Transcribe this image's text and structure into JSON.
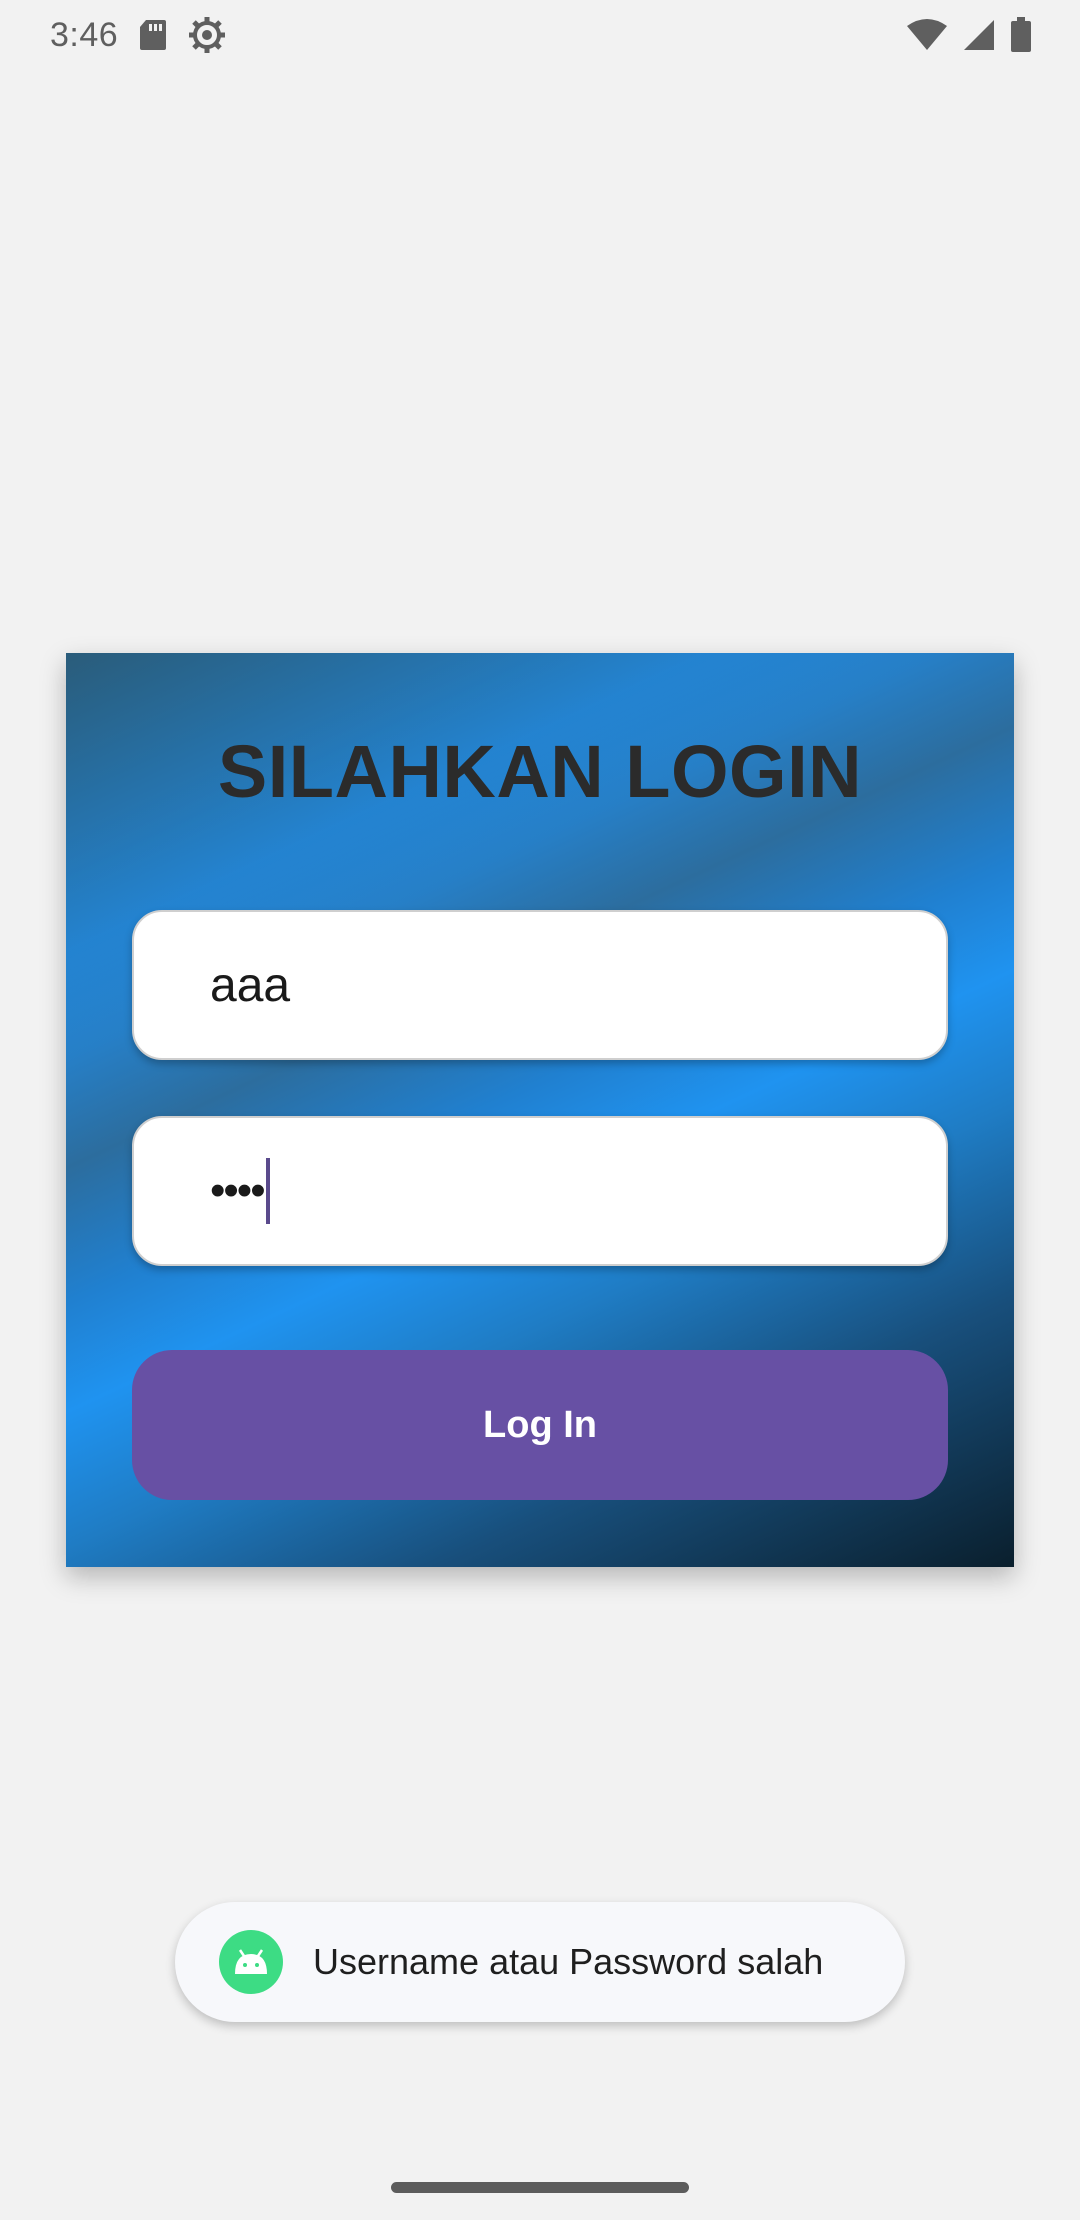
{
  "status_bar": {
    "time": "3:46",
    "left_icons": [
      "sd-card-icon",
      "settings-gear-icon"
    ],
    "right_icons": [
      "wifi-icon",
      "cellular-signal-icon",
      "battery-icon"
    ]
  },
  "login": {
    "title": "SILAHKAN LOGIN",
    "username_value": "aaa",
    "password_mask": "••••",
    "button_label": "Log In",
    "button_color": "#6750a4"
  },
  "toast": {
    "icon": "android-icon",
    "message": "Username atau Password salah"
  }
}
